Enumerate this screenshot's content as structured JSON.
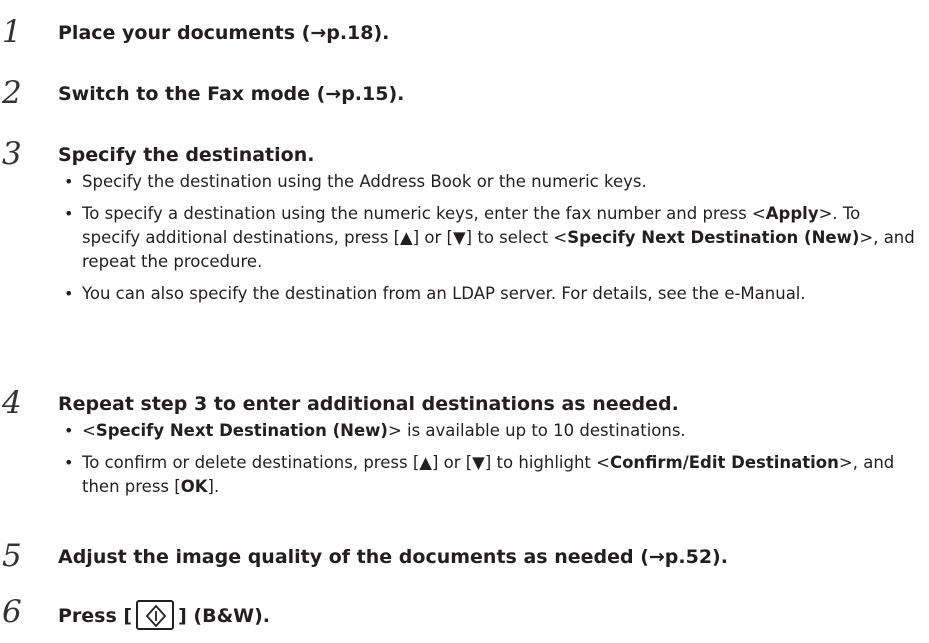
{
  "steps": [
    {
      "num": "1",
      "text": "Place your documents (→p.18)."
    },
    {
      "num": "2",
      "text": "Switch to the Fax mode (→p.15)."
    },
    {
      "num": "3",
      "text": "Specify the destination."
    },
    {
      "num": "4",
      "text": "Repeat step 3 to enter additional destinations as needed."
    },
    {
      "num": "5",
      "text": "Adjust the image quality of the documents as needed (→p.52)."
    },
    {
      "num": "6",
      "text_before": "Press [",
      "text_after": "] (B&W)."
    }
  ],
  "step3_bullets": {
    "b1": "Specify the destination using the Address Book or the numeric keys.",
    "b2_pre": "To specify a destination using the numeric keys, enter the fax number and press <",
    "b2_apply": "Apply",
    "b2_mid": ">. To specify additional destinations, press [▲] or [▼] to select <",
    "b2_next": "Specify Next Destination (New)",
    "b2_post": ">, and repeat the procedure.",
    "b3": "You can also specify the destination from an LDAP server. For details, see the e-Manual."
  },
  "step4_bullets": {
    "b1_pre": "<",
    "b1_bold": "Specify Next Destination (New)",
    "b1_post": "> is available up to 10 destinations.",
    "b2_pre": "To confirm or delete destinations, press [▲] or [▼] to highlight <",
    "b2_bold": "Confirm/Edit Destination",
    "b2_mid": ">, and then press [",
    "b2_ok": "OK",
    "b2_post": "]."
  },
  "bullet_glyph": "•",
  "icons": {
    "start_key": "start-key-icon"
  }
}
